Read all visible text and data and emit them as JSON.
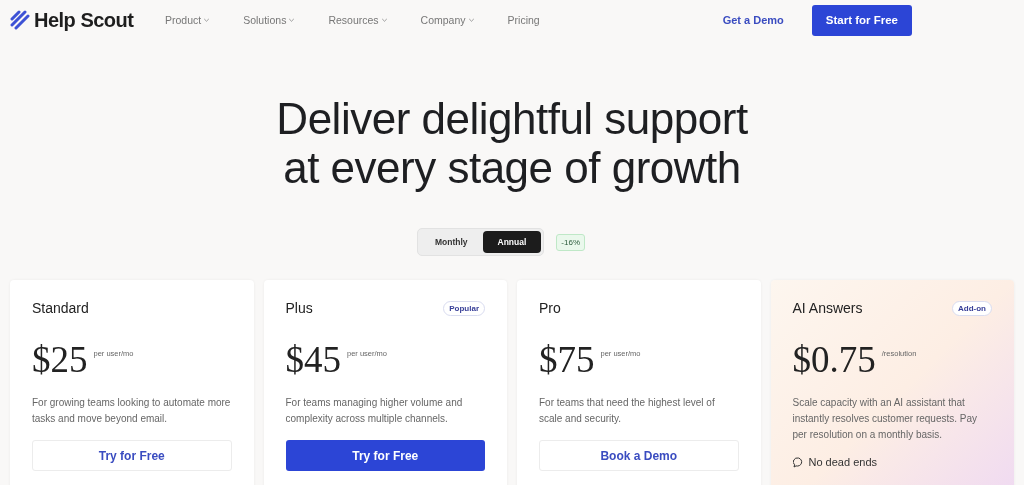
{
  "nav": {
    "brand": "Help Scout",
    "items": [
      {
        "label": "Product",
        "dropdown": true
      },
      {
        "label": "Solutions",
        "dropdown": true
      },
      {
        "label": "Resources",
        "dropdown": true
      },
      {
        "label": "Company",
        "dropdown": true
      },
      {
        "label": "Pricing",
        "dropdown": false
      }
    ],
    "demo_link": "Get a Demo",
    "start_button": "Start for Free"
  },
  "hero": {
    "title_lines": [
      "Deliver delightful support",
      "at every stage of growth"
    ]
  },
  "billing_toggle": {
    "options": [
      {
        "label": "Monthly",
        "selected": false
      },
      {
        "label": "Annual",
        "selected": true
      }
    ],
    "discount": "-16%"
  },
  "plans": [
    {
      "kind": "standard",
      "name": "Standard",
      "price": "$25",
      "unit": "per user/mo",
      "description": "For growing teams looking to automate more tasks and move beyond email.",
      "cta": {
        "label": "Try for Free",
        "kind": "outline"
      }
    },
    {
      "kind": "standard",
      "name": "Plus",
      "badge": "Popular",
      "price": "$45",
      "unit": "per user/mo",
      "description": "For teams managing higher volume and complexity across multiple channels.",
      "cta": {
        "label": "Try for Free",
        "kind": "primary"
      }
    },
    {
      "kind": "standard",
      "name": "Pro",
      "price": "$75",
      "unit": "per user/mo",
      "description": "For teams that need the highest level of scale and security.",
      "cta": {
        "label": "Book a Demo",
        "kind": "outline"
      }
    },
    {
      "kind": "addon",
      "name": "AI Answers",
      "badge": "Add-on",
      "price": "$0.75",
      "unit": "/resolution",
      "description": "Scale capacity with an AI assistant that instantly resolves customer requests. Pay per resolution on a monthly basis.",
      "feature": "No dead ends"
    }
  ]
}
